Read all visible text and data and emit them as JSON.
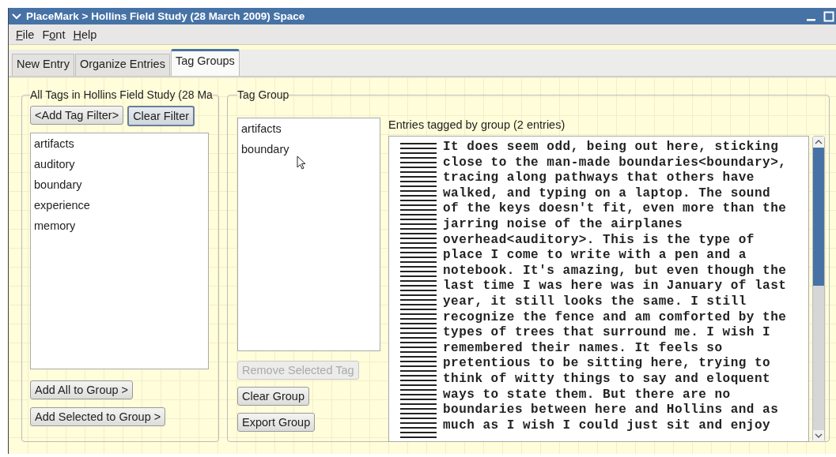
{
  "window": {
    "title": "PlaceMark > Hollins Field Study (28 March 2009) Space"
  },
  "menu": [
    {
      "key": "F",
      "rest": "ile"
    },
    {
      "lead": "F",
      "key": "o",
      "rest": "nt"
    },
    {
      "key": "H",
      "rest": "elp"
    }
  ],
  "tabs": [
    {
      "label": "New Entry",
      "selected": false
    },
    {
      "label": "Organize Entries",
      "selected": false
    },
    {
      "label": "Tag Groups",
      "selected": true
    }
  ],
  "all_tags": {
    "title": "All Tags in Hollins Field Study (28 Ma",
    "add_filter_button": "<Add Tag Filter>",
    "clear_filter_button": "Clear Filter",
    "items": [
      "artifacts",
      "auditory",
      "boundary",
      "experience",
      "memory"
    ],
    "add_all_button": "Add All to Group >",
    "add_selected_button": "Add Selected to Group >"
  },
  "tag_group": {
    "title": "Tag Group",
    "items": [
      "artifacts",
      "boundary"
    ],
    "buttons": [
      {
        "label": "Remove Selected Tag",
        "disabled": true
      },
      {
        "label": "Clear Group",
        "disabled": false
      },
      {
        "label": "Export Group",
        "disabled": false
      }
    ],
    "entries_label": "Entries tagged by group (2 entries)",
    "entry_text": "It does seem odd, being out here, sticking\nclose to the man-made boundaries<boundary>,\ntracing along pathways that others have\nwalked, and typing on a laptop. The sound\nof the keys doesn't fit, even more than the\njarring noise of the airplanes\noverhead<auditory>. This is the type of\nplace I come to write with a pen and a\nnotebook. It's amazing, but even though the\nlast time I was here was in January of last\nyear, it still looks the same. I still\nrecognize the fence and am comforted by the\ntypes of trees that surround me. I wish I\nremembered their names. It feels so\npretentious to be sitting here, trying to\nthink of witty things to say and eloquent\nways to state them. But there are no\nboundaries between here and Hollins and as\nmuch as I wish I could just sit and enjoy"
  }
}
